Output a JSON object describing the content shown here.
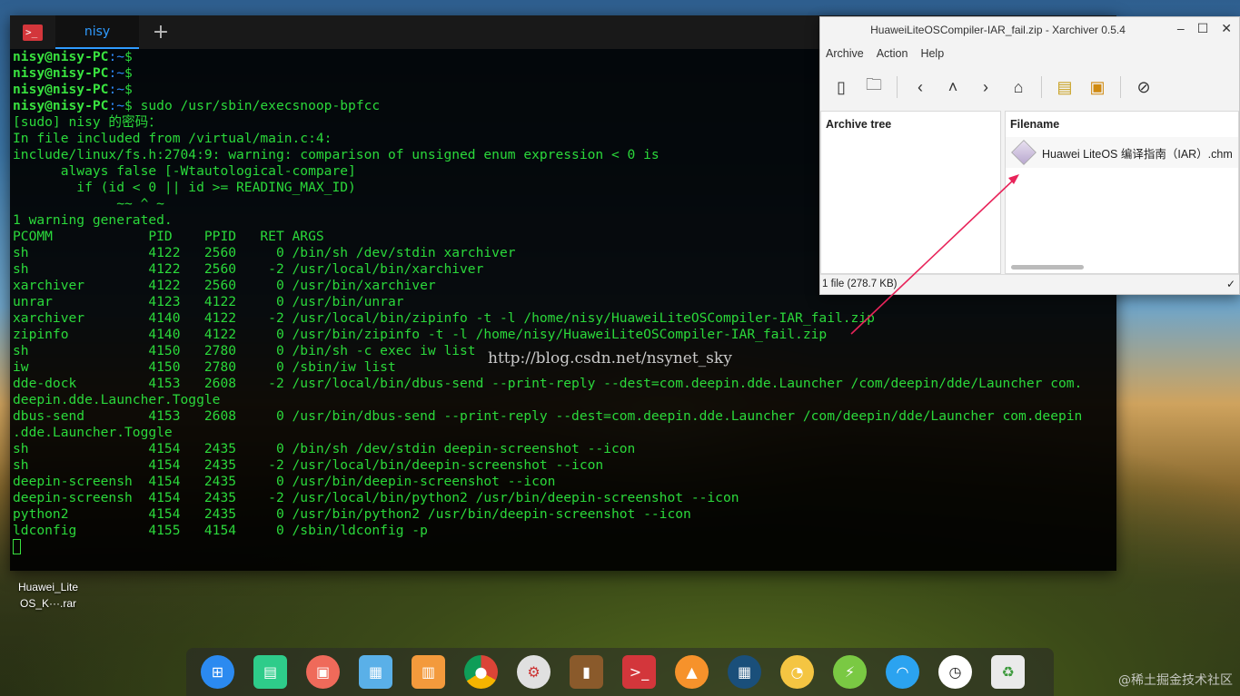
{
  "terminal": {
    "tab_label": "nisy",
    "lines": [
      {
        "user": "nisy@nisy-PC",
        "path": ":~",
        "rest": "$"
      },
      {
        "user": "nisy@nisy-PC",
        "path": ":~",
        "rest": "$"
      },
      {
        "user": "nisy@nisy-PC",
        "path": ":~",
        "rest": "$"
      },
      {
        "user": "nisy@nisy-PC",
        "path": ":~",
        "rest": "$ sudo /usr/sbin/execsnoop-bpfcc"
      },
      {
        "text": "[sudo] nisy 的密码："
      },
      {
        "text": "In file included from /virtual/main.c:4:"
      },
      {
        "text": "include/linux/fs.h:2704:9: warning: comparison of unsigned enum expression < 0 is"
      },
      {
        "text": "      always false [-Wtautological-compare]"
      },
      {
        "text": "        if (id < 0 || id >= READING_MAX_ID)"
      },
      {
        "text": "             ~~ ^ ~"
      },
      {
        "text": "1 warning generated."
      },
      {
        "text": "PCOMM            PID    PPID   RET ARGS"
      },
      {
        "text": "sh               4122   2560     0 /bin/sh /dev/stdin xarchiver"
      },
      {
        "text": "sh               4122   2560    -2 /usr/local/bin/xarchiver"
      },
      {
        "text": "xarchiver        4122   2560     0 /usr/bin/xarchiver"
      },
      {
        "text": "unrar            4123   4122     0 /usr/bin/unrar"
      },
      {
        "text": "xarchiver        4140   4122    -2 /usr/local/bin/zipinfo -t -l /home/nisy/HuaweiLiteOSCompiler-IAR_fail.zip"
      },
      {
        "text": "zipinfo          4140   4122     0 /usr/bin/zipinfo -t -l /home/nisy/HuaweiLiteOSCompiler-IAR_fail.zip"
      },
      {
        "text": "sh               4150   2780     0 /bin/sh -c exec iw list"
      },
      {
        "text": "iw               4150   2780     0 /sbin/iw list"
      },
      {
        "text": "dde-dock         4153   2608    -2 /usr/local/bin/dbus-send --print-reply --dest=com.deepin.dde.Launcher /com/deepin/dde/Launcher com."
      },
      {
        "text": "deepin.dde.Launcher.Toggle"
      },
      {
        "text": "dbus-send        4153   2608     0 /usr/bin/dbus-send --print-reply --dest=com.deepin.dde.Launcher /com/deepin/dde/Launcher com.deepin"
      },
      {
        "text": ".dde.Launcher.Toggle"
      },
      {
        "text": "sh               4154   2435     0 /bin/sh /dev/stdin deepin-screenshot --icon"
      },
      {
        "text": "sh               4154   2435    -2 /usr/local/bin/deepin-screenshot --icon"
      },
      {
        "text": "deepin-screensh  4154   2435     0 /usr/bin/deepin-screenshot --icon"
      },
      {
        "text": "deepin-screensh  4154   2435    -2 /usr/local/bin/python2 /usr/bin/deepin-screenshot --icon"
      },
      {
        "text": "python2          4154   2435     0 /usr/bin/python2 /usr/bin/deepin-screenshot --icon"
      },
      {
        "text": "ldconfig         4155   4154     0 /sbin/ldconfig -p"
      }
    ]
  },
  "watermark": "http://blog.csdn.net/nsynet_sky",
  "xarchiver": {
    "title": "HuaweiLiteOSCompiler-IAR_fail.zip - Xarchiver 0.5.4",
    "menu": [
      "Archive",
      "Action",
      "Help"
    ],
    "tree_header": "Archive tree",
    "files_header": "Filename",
    "file_name": "Huawei LiteOS 编译指南（IAR）.chm",
    "status": "1 file  (278.7 KB)"
  },
  "desktop_icon": {
    "line1": "Huawei_Lite",
    "line2": "OS_K···.rar"
  },
  "dock_apps": [
    "launcher",
    "file-manager",
    "screen-recorder",
    "deepin-store",
    "app-store",
    "chrome",
    "settings",
    "archive-manager",
    "terminal",
    "vlc",
    "appstore-dot",
    "image-viewer",
    "power",
    "wifi",
    "clock",
    "trash"
  ],
  "corner_mark": "@稀土掘金技术社区",
  "accent": "#2f9bff",
  "term_green": "#2bd93b"
}
